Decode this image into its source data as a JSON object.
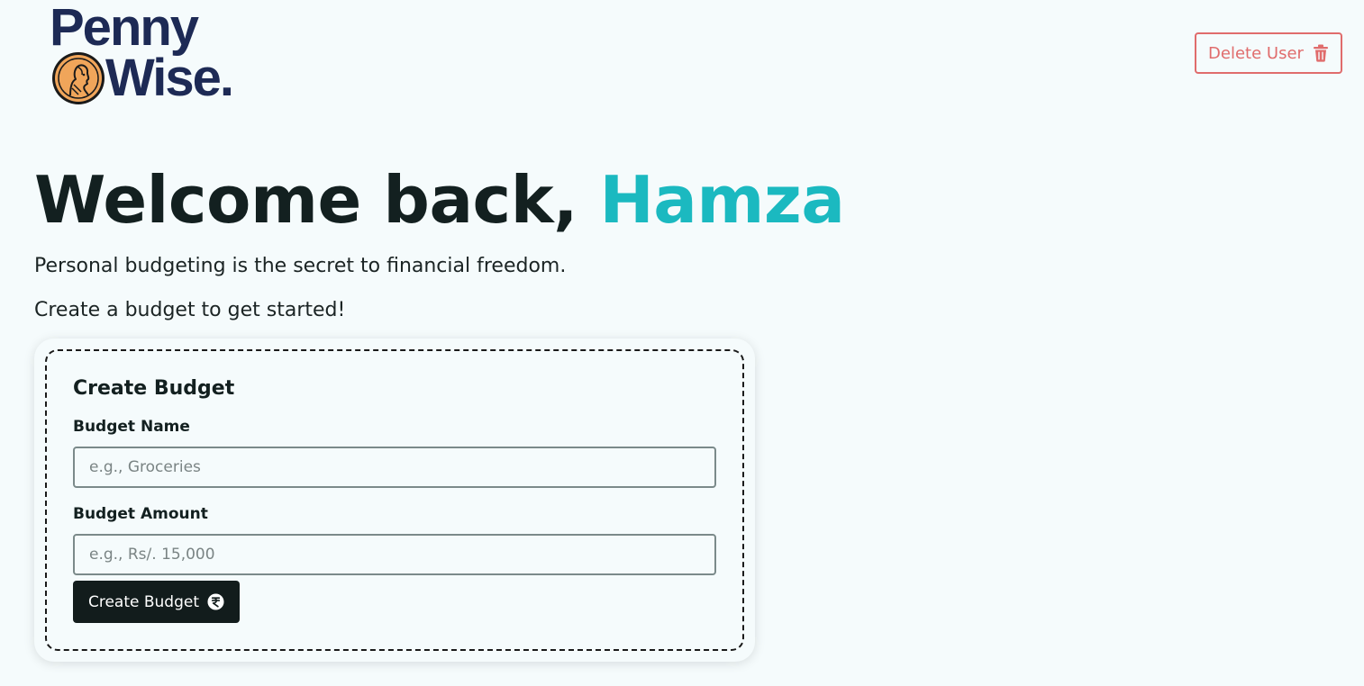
{
  "header": {
    "logo_line1": "Penny",
    "logo_line2": "Wise.",
    "delete_button_label": "Delete User",
    "delete_icon": "trash-icon"
  },
  "main": {
    "welcome_prefix": "Welcome back, ",
    "user_name": "Hamza",
    "tagline": "Personal budgeting is the secret to financial freedom.",
    "cta": "Create a budget to get started!"
  },
  "form": {
    "title": "Create Budget",
    "name_label": "Budget Name",
    "name_placeholder": "e.g., Groceries",
    "name_value": "",
    "amount_label": "Budget Amount",
    "amount_placeholder": "e.g., Rs/. 15,000",
    "amount_value": "",
    "submit_label": "Create Budget",
    "submit_icon": "currency-coin-icon"
  },
  "colors": {
    "background": "#f5fbfc",
    "accent": "#1bb9c0",
    "brand_navy": "#1d2a55",
    "danger": "#e06c6c",
    "coin_orange": "#f0a55a",
    "button_dark": "#121c1c"
  }
}
